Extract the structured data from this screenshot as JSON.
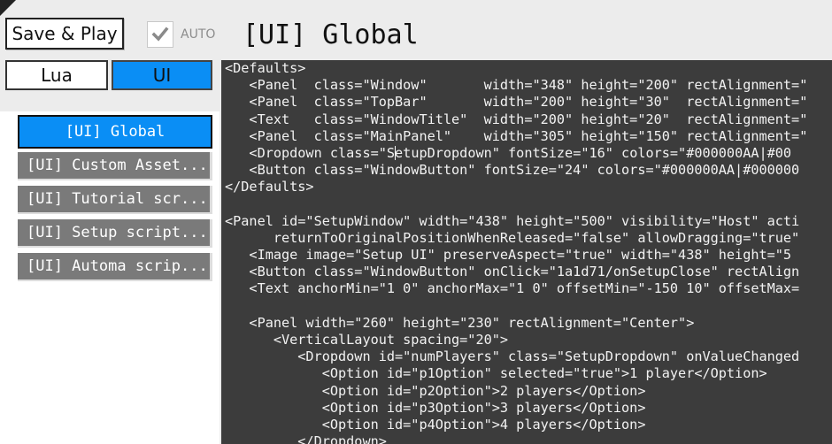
{
  "toolbar": {
    "save_play_label": "Save & Play",
    "auto_label": "AUTO",
    "auto_checked": true
  },
  "header": {
    "title": "[UI] Global"
  },
  "tabs": [
    {
      "label": "Lua",
      "active": false
    },
    {
      "label": "UI",
      "active": true
    }
  ],
  "scripts": [
    {
      "label": "[UI] Global",
      "active": true
    },
    {
      "label": "[UI] Custom Asset...",
      "active": false
    },
    {
      "label": "[UI] Tutorial scr...",
      "active": false
    },
    {
      "label": "[UI] Setup script...",
      "active": false
    },
    {
      "label": "[UI] Automa scrip...",
      "active": false
    }
  ],
  "editor": {
    "lines": [
      "<Defaults>",
      "   <Panel  class=\"Window\"       width=\"348\" height=\"200\" rectAlignment=\"",
      "   <Panel  class=\"TopBar\"       width=\"200\" height=\"30\"  rectAlignment=\"",
      "   <Text   class=\"WindowTitle\"  width=\"200\" height=\"20\"  rectAlignment=\"",
      "   <Panel  class=\"MainPanel\"    width=\"305\" height=\"150\" rectAlignment=\"",
      "   <Dropdown class=\"SetupDropdown\" fontSize=\"16\" colors=\"#000000AA|#00",
      "   <Button class=\"WindowButton\" fontSize=\"24\" colors=\"#000000AA|#000000",
      "</Defaults>",
      "",
      "<Panel id=\"SetupWindow\" width=\"438\" height=\"500\" visibility=\"Host\" acti",
      "      returnToOriginalPositionWhenReleased=\"false\" allowDragging=\"true\"",
      "   <Image image=\"Setup UI\" preserveAspect=\"true\" width=\"438\" height=\"5",
      "   <Button class=\"WindowButton\" onClick=\"1a1d71/onSetupClose\" rectAlign",
      "   <Text anchorMin=\"1 0\" anchorMax=\"1 0\" offsetMin=\"-150 10\" offsetMax=",
      "",
      "   <Panel width=\"260\" height=\"230\" rectAlignment=\"Center\">",
      "      <VerticalLayout spacing=\"20\">",
      "         <Dropdown id=\"numPlayers\" class=\"SetupDropdown\" onValueChanged",
      "            <Option id=\"p1Option\" selected=\"true\">1 player</Option>",
      "            <Option id=\"p2Option\">2 players</Option>",
      "            <Option id=\"p3Option\">3 players</Option>",
      "            <Option id=\"p4Option\">4 players</Option>",
      "         </Dropdown>"
    ]
  }
}
